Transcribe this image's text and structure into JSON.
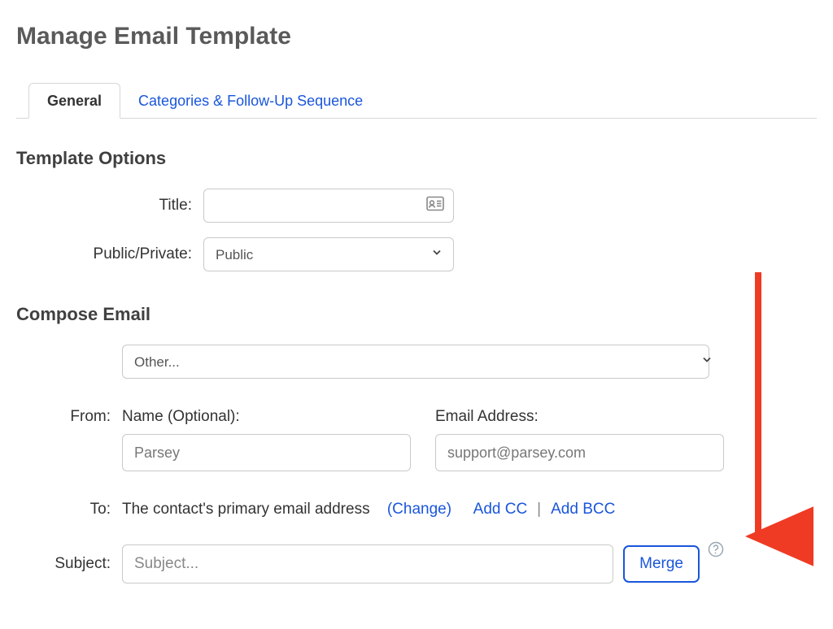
{
  "page_title": "Manage Email Template",
  "tabs": [
    {
      "label": "General",
      "active": true
    },
    {
      "label": "Categories & Follow-Up Sequence",
      "active": false
    }
  ],
  "template_options": {
    "heading": "Template Options",
    "title_label": "Title:",
    "title_value": "",
    "visibility_label": "Public/Private:",
    "visibility_selected": "Public"
  },
  "compose": {
    "heading": "Compose Email",
    "other_selected": "Other...",
    "from_label": "From:",
    "name_label": "Name (Optional):",
    "name_value": "Parsey",
    "email_label": "Email Address:",
    "email_value": "support@parsey.com",
    "to_label": "To:",
    "to_text": "The contact's primary email address",
    "change_link": "(Change)",
    "add_cc": "Add CC",
    "add_bcc": "Add BCC",
    "subject_label": "Subject:",
    "subject_placeholder": "Subject...",
    "merge_button": "Merge"
  }
}
